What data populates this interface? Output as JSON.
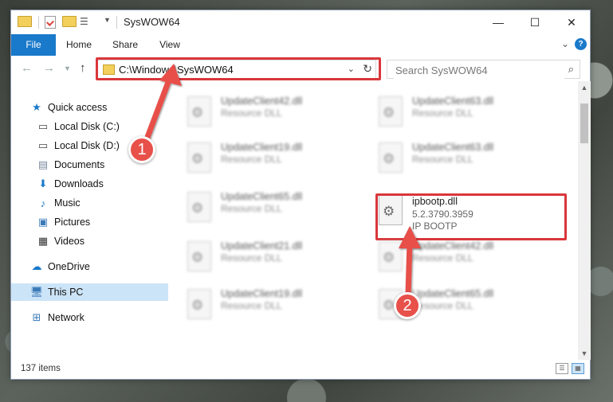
{
  "window": {
    "title": "SysWOW64"
  },
  "ribbon": {
    "tabs": [
      {
        "label": "File"
      },
      {
        "label": "Home"
      },
      {
        "label": "Share"
      },
      {
        "label": "View"
      }
    ],
    "help_label": "?",
    "expand_label": "⌄"
  },
  "address": {
    "path": "C:\\Windows\\SysWOW64"
  },
  "search": {
    "placeholder": "Search SysWOW64"
  },
  "navpane": {
    "items": [
      {
        "label": "Quick access",
        "icon": "star-icon"
      },
      {
        "label": "Local Disk (C:)",
        "icon": "drive-icon"
      },
      {
        "label": "Local Disk (D:)",
        "icon": "drive-icon"
      },
      {
        "label": "Documents",
        "icon": "documents-icon"
      },
      {
        "label": "Downloads",
        "icon": "download-icon"
      },
      {
        "label": "Music",
        "icon": "music-icon"
      },
      {
        "label": "Pictures",
        "icon": "pictures-icon"
      },
      {
        "label": "Videos",
        "icon": "videos-icon"
      },
      {
        "label": "OneDrive",
        "icon": "cloud-icon"
      },
      {
        "label": "This PC",
        "icon": "pc-icon",
        "selected": true
      },
      {
        "label": "Network",
        "icon": "network-icon"
      }
    ]
  },
  "files": [
    {
      "name": "UpdateClient42.dll",
      "desc": "Resource DLL"
    },
    {
      "name": "UpdateClient63.dll",
      "desc": "Resource DLL"
    },
    {
      "name": "UpdateClient19.dll",
      "desc": "Resource DLL"
    },
    {
      "name": "UpdateClient63.dll",
      "desc": "Resource DLL"
    },
    {
      "name": "UpdateClient65.dll",
      "desc": "Resource DLL"
    },
    {
      "name": "ipbootp.dll",
      "version": "5.2.3790.3959",
      "desc": "IP BOOTP"
    },
    {
      "name": "UpdateClient21.dll",
      "desc": "Resource DLL"
    },
    {
      "name": "UpdateClient42.dll",
      "desc": "Resource DLL"
    },
    {
      "name": "UpdateClient19.dll",
      "desc": "Resource DLL"
    },
    {
      "name": "UpdateClient65.dll",
      "desc": "Resource DLL"
    }
  ],
  "status": {
    "item_count": "137 items"
  },
  "annotations": {
    "badge1": "1",
    "badge2": "2",
    "color": "#e8504a"
  }
}
